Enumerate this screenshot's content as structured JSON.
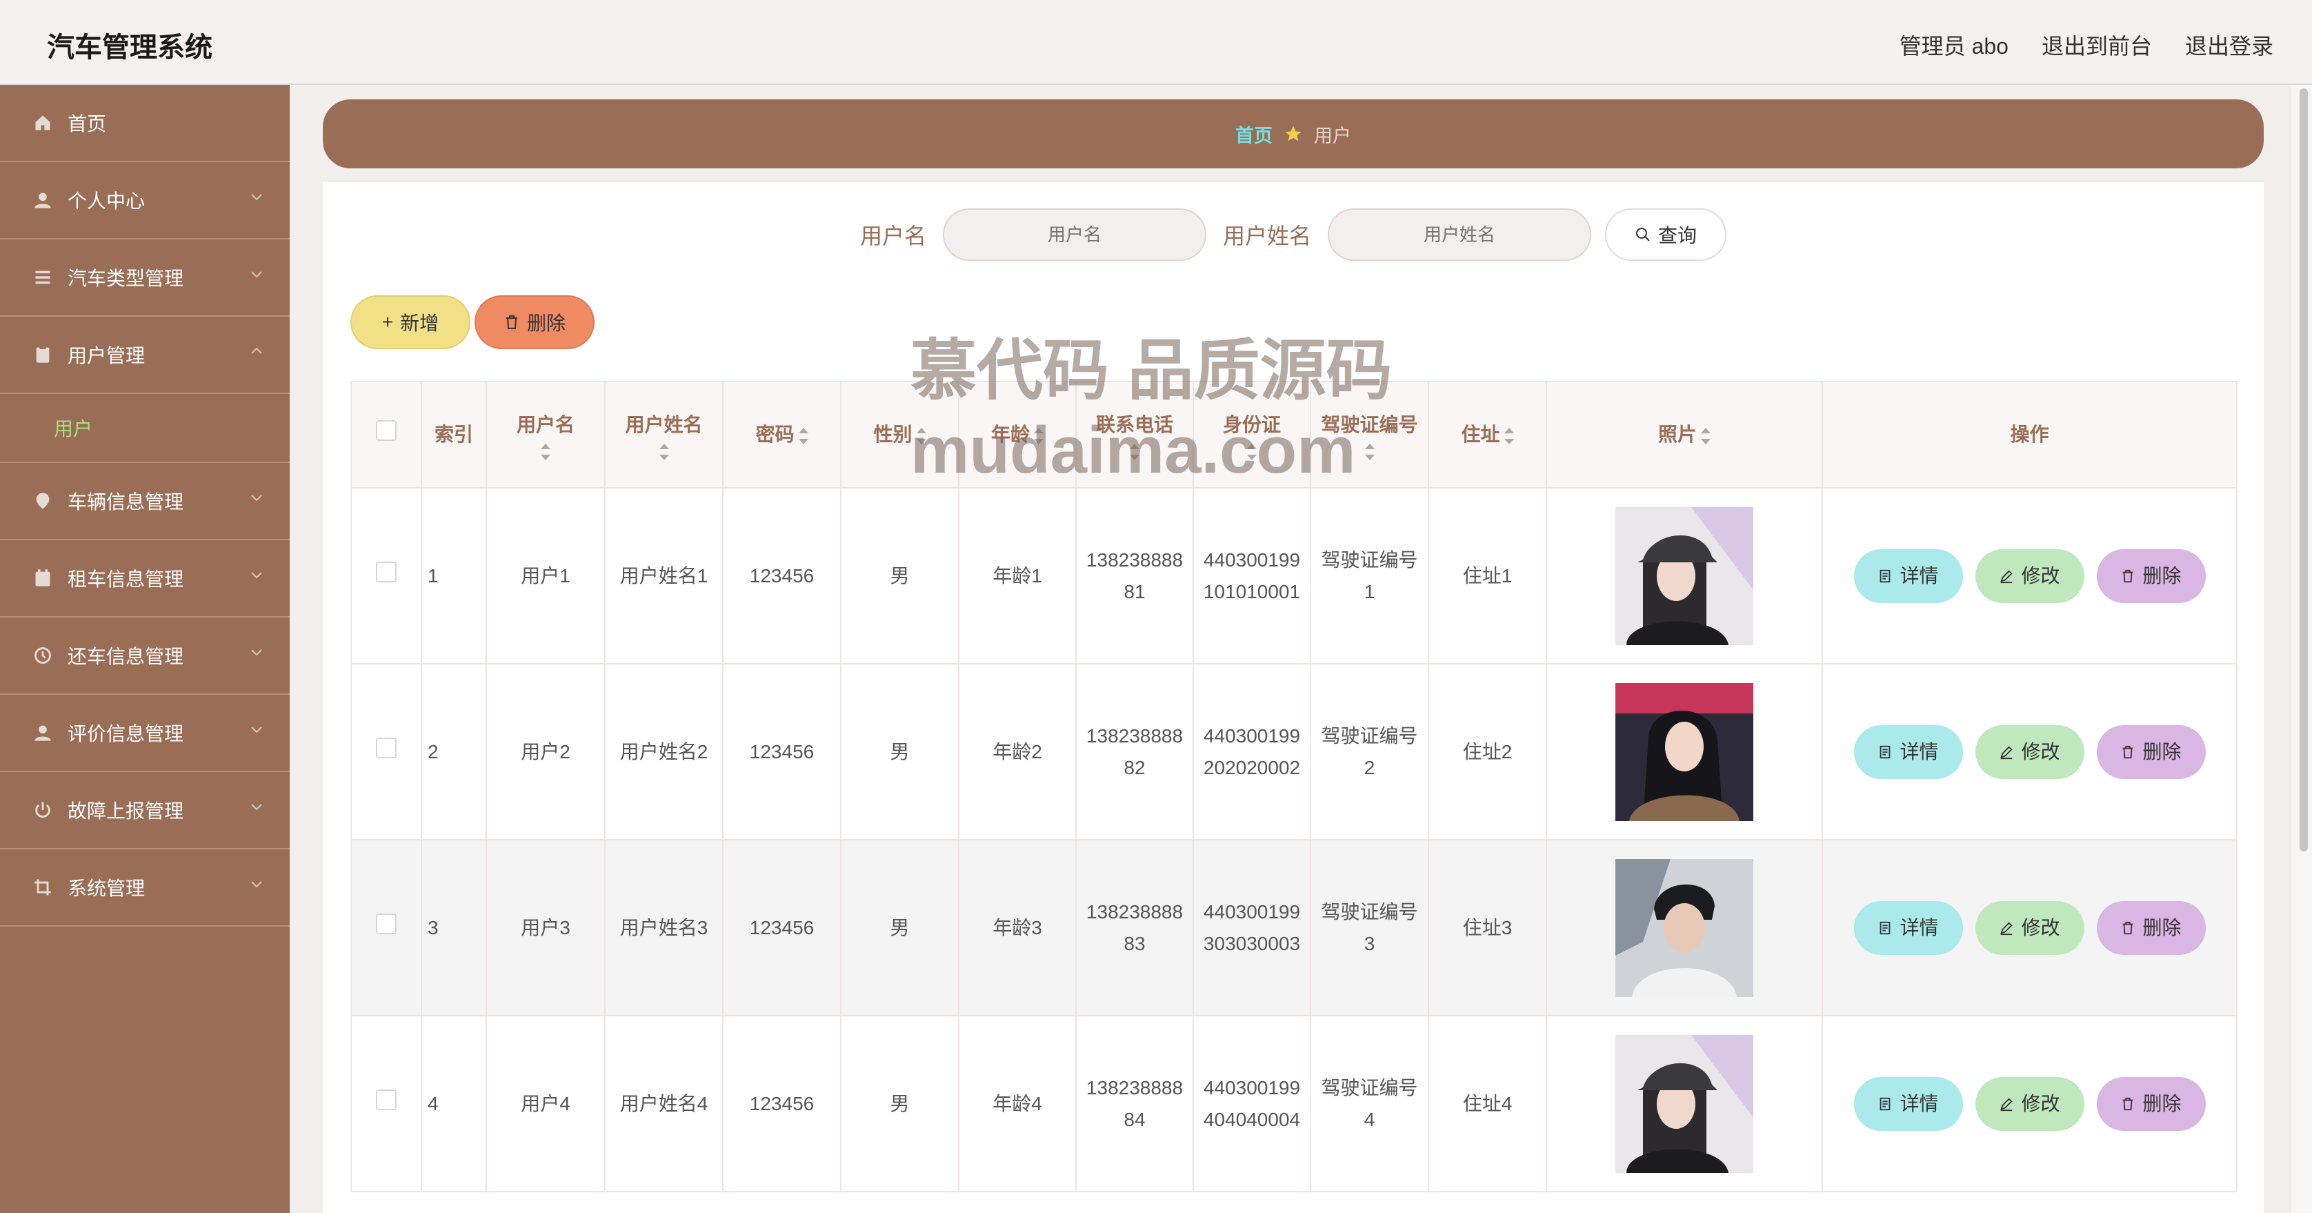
{
  "header": {
    "app_title": "汽车管理系统",
    "links": [
      "管理员 abo",
      "退出到前台",
      "退出登录"
    ]
  },
  "sidebar": {
    "items": [
      {
        "label": "首页",
        "icon": "home-icon",
        "expandable": false
      },
      {
        "label": "个人中心",
        "icon": "user-icon",
        "expandable": true
      },
      {
        "label": "汽车类型管理",
        "icon": "menu-icon",
        "expandable": true
      },
      {
        "label": "用户管理",
        "icon": "clipboard-icon",
        "expandable": true,
        "expanded": true,
        "children": [
          "用户"
        ]
      },
      {
        "label": "车辆信息管理",
        "icon": "location-icon",
        "expandable": true
      },
      {
        "label": "租车信息管理",
        "icon": "calendar-icon",
        "expandable": true
      },
      {
        "label": "还车信息管理",
        "icon": "return-icon",
        "expandable": true
      },
      {
        "label": "评价信息管理",
        "icon": "user-icon",
        "expandable": true
      },
      {
        "label": "故障上报管理",
        "icon": "power-icon",
        "expandable": true
      },
      {
        "label": "系统管理",
        "icon": "crop-icon",
        "expandable": true
      }
    ]
  },
  "breadcrumb": {
    "home": "首页",
    "current": "用户"
  },
  "search": {
    "username_label": "用户名",
    "username_placeholder": "用户名",
    "fullname_label": "用户姓名",
    "fullname_placeholder": "用户姓名",
    "query_button": "查询"
  },
  "actions": {
    "add": "新增",
    "delete": "删除"
  },
  "table": {
    "columns": [
      "索引",
      "用户名",
      "用户姓名",
      "密码",
      "性别",
      "年龄",
      "联系电话",
      "身份证",
      "驾驶证编号",
      "住址",
      "照片",
      "操作"
    ],
    "rows": [
      {
        "index": "1",
        "username": "用户1",
        "fullname": "用户姓名1",
        "password": "123456",
        "gender": "男",
        "age": "年龄1",
        "phone": "13823888881",
        "id_card": "440300199101010001",
        "license": "驾驶证编号1",
        "address": "住址1"
      },
      {
        "index": "2",
        "username": "用户2",
        "fullname": "用户姓名2",
        "password": "123456",
        "gender": "男",
        "age": "年龄2",
        "phone": "13823888882",
        "id_card": "440300199202020002",
        "license": "驾驶证编号2",
        "address": "住址2"
      },
      {
        "index": "3",
        "username": "用户3",
        "fullname": "用户姓名3",
        "password": "123456",
        "gender": "男",
        "age": "年龄3",
        "phone": "13823888883",
        "id_card": "440300199303030003",
        "license": "驾驶证编号3",
        "address": "住址3"
      },
      {
        "index": "4",
        "username": "用户4",
        "fullname": "用户姓名4",
        "password": "123456",
        "gender": "男",
        "age": "年龄4",
        "phone": "13823888884",
        "id_card": "440300199404040004",
        "license": "驾驶证编号4",
        "address": "住址4"
      }
    ],
    "row_actions": {
      "detail": "详情",
      "edit": "修改",
      "delete": "删除"
    }
  },
  "watermark": {
    "line1": "慕代码 品质源码",
    "line2": "mudaima.com"
  },
  "colors": {
    "primary": "#9a6e56",
    "accent": "#74e0e3",
    "submenu_active": "#a8e07f"
  }
}
